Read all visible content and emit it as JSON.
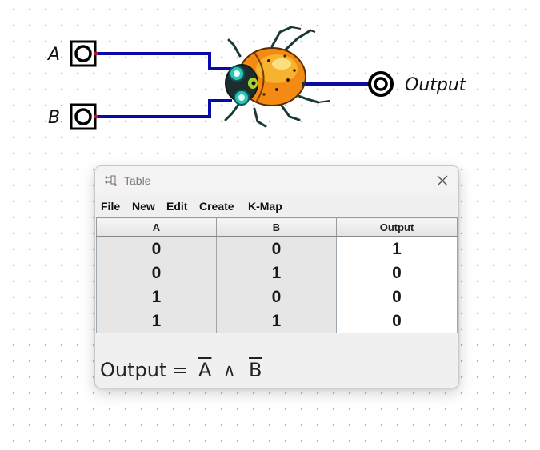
{
  "canvas": {
    "input_a_label": "A",
    "input_b_label": "B",
    "output_label": "Output",
    "gate_icon": "bug-nor-gate-icon",
    "wire_color": "#0a0aa8"
  },
  "table_window": {
    "title": "Table",
    "title_icon": "truth-table-icon",
    "close_icon": "close-icon",
    "menu": [
      "File",
      "New",
      "Edit",
      "Create",
      "K-Map"
    ],
    "columns": [
      "A",
      "B",
      "Output"
    ],
    "rows": [
      [
        "0",
        "0",
        "1"
      ],
      [
        "0",
        "1",
        "0"
      ],
      [
        "1",
        "0",
        "0"
      ],
      [
        "1",
        "1",
        "0"
      ]
    ],
    "expression": {
      "lhs": "Output",
      "equals": "=",
      "term1": "A",
      "operator": "∧",
      "term2": "B"
    }
  }
}
